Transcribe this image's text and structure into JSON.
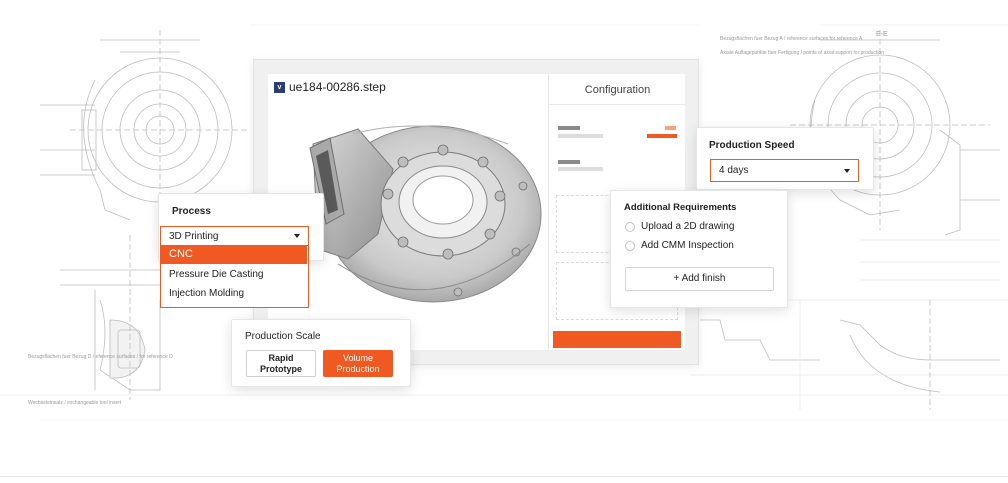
{
  "viewer": {
    "file_badge": "v",
    "file_name": "ue184-00286.step"
  },
  "configuration": {
    "title": "Configuration"
  },
  "process": {
    "title": "Process",
    "selected": "3D Printing",
    "options": [
      "CNC",
      "Pressure Die Casting",
      "Injection Molding"
    ],
    "highlighted_index": 0
  },
  "production_scale": {
    "title": "Production Scale",
    "options": [
      "Rapid Prototype",
      "Volume Production"
    ],
    "selected_index": 1
  },
  "additional_requirements": {
    "title": "Additional Requirements",
    "options": [
      "Upload a 2D drawing",
      "Add CMM Inspection"
    ],
    "add_finish_label": "+ Add finish"
  },
  "production_speed": {
    "title": "Production Speed",
    "selected": "4 days"
  },
  "drawing_notes": {
    "left_note": "Bezugsflächen fuer Bezug D / eference surfaces / for reference D",
    "left_note_2": "Wechseleinsatz / exchangeable tool insert",
    "right_note_1": "Bezugsflächen fuer Bezug A / reference surfaces for reference A",
    "right_note_2": "Axiale Auflagepunkte fuer Fertigung / points of axial support for production",
    "section_label": "E-E"
  },
  "colors": {
    "accent": "#f05a22",
    "panel_bg": "#ffffff",
    "card_bg": "#f0f0f0",
    "text": "#1f1f1f"
  }
}
